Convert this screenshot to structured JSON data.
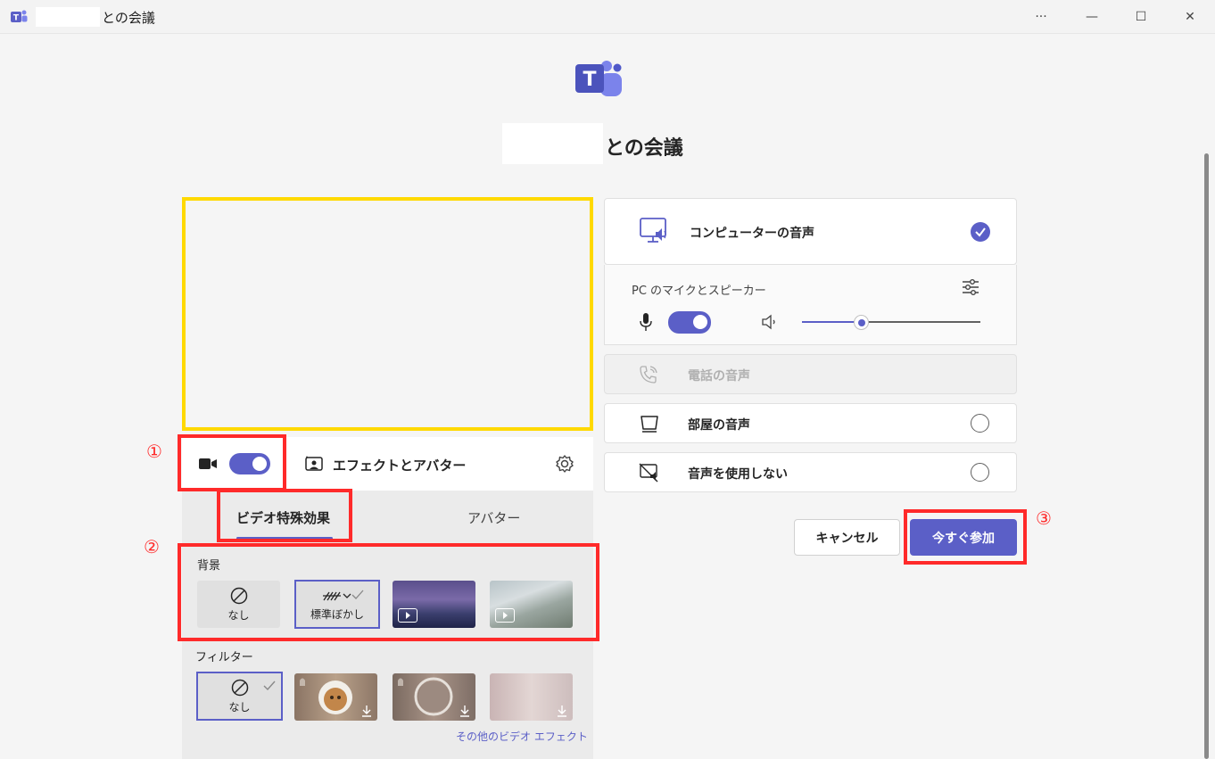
{
  "window": {
    "title": "との会議",
    "controls": {
      "more": "···",
      "minimize": "—",
      "maximize": "☐",
      "close": "✕"
    }
  },
  "meeting": {
    "title": "との会議"
  },
  "video": {
    "camera_on": true,
    "effects_label": "エフェクトとアバター"
  },
  "effects": {
    "tabs": [
      {
        "label": "ビデオ特殊効果",
        "active": true
      },
      {
        "label": "アバター",
        "active": false
      }
    ],
    "background_label": "背景",
    "backgrounds": [
      {
        "label": "なし",
        "selected": false
      },
      {
        "label": "標準ぼかし",
        "selected": true
      },
      {
        "label": "",
        "selected": false
      },
      {
        "label": "",
        "selected": false
      }
    ],
    "filter_label": "フィルター",
    "filters": [
      {
        "label": "なし",
        "selected": true
      }
    ],
    "more_effects": "その他のビデオ エフェクト"
  },
  "audio": {
    "pc_audio": {
      "label": "コンピューターの音声",
      "selected": true
    },
    "pc_sub_label": "PC のマイクとスピーカー",
    "mic_on": true,
    "speaker_volume": 0.34,
    "phone_audio": {
      "label": "電話の音声",
      "enabled": false
    },
    "room_audio": {
      "label": "部屋の音声",
      "selected": false
    },
    "no_audio": {
      "label": "音声を使用しない",
      "selected": false
    }
  },
  "actions": {
    "cancel": "キャンセル",
    "join": "今すぐ参加"
  },
  "annotations": [
    "①",
    "②",
    "③"
  ],
  "colors": {
    "accent": "#5b5fc7",
    "highlight_yellow": "#ffd900",
    "annotation_red": "#ff2a2a"
  }
}
